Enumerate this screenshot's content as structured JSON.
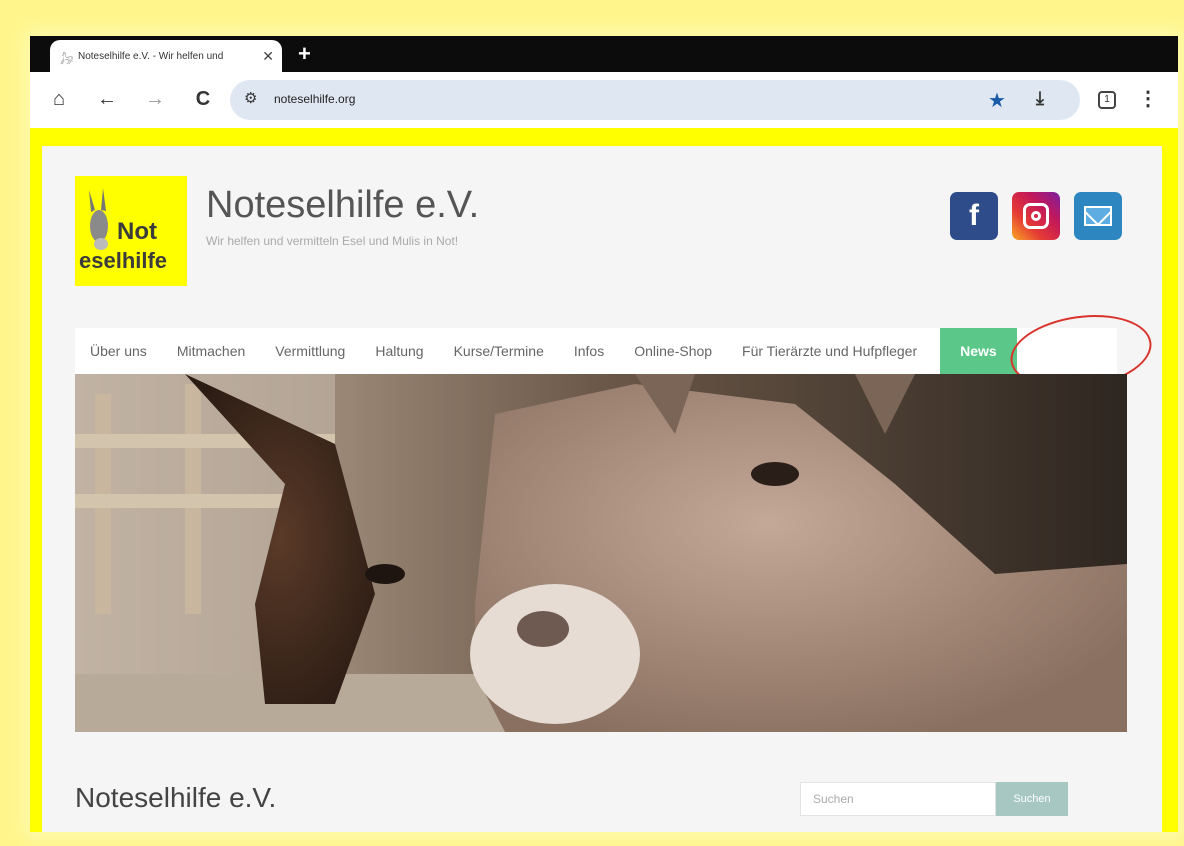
{
  "browser": {
    "tab_title": "Noteselhilfe e.V. - Wir helfen und",
    "new_tab_label": "+",
    "close_label": "✕",
    "url": "noteselhilfe.org",
    "tab_count": "1"
  },
  "site": {
    "logo_line1": "Not",
    "logo_line2": "eselhilfe",
    "title": "Noteselhilfe e.V.",
    "tagline": "Wir helfen und vermitteln Esel und Mulis in Not!",
    "social": {
      "facebook_glyph": "f"
    }
  },
  "nav": {
    "items": [
      {
        "label": "Über uns"
      },
      {
        "label": "Mitmachen"
      },
      {
        "label": "Vermittlung"
      },
      {
        "label": "Haltung"
      },
      {
        "label": "Kurse/Termine"
      },
      {
        "label": "Infos"
      },
      {
        "label": "Online-Shop"
      },
      {
        "label": "Für Tierärzte und Hufpfleger"
      },
      {
        "label": "News"
      }
    ],
    "active_color": "#5bc889"
  },
  "content": {
    "title": "Noteselhilfe e.V."
  },
  "search": {
    "placeholder": "Suchen",
    "button_label": "Suchen"
  },
  "colors": {
    "frame": "#ffff00",
    "url_bar": "#dfe8f2",
    "annotation_circle": "#d9342b"
  }
}
